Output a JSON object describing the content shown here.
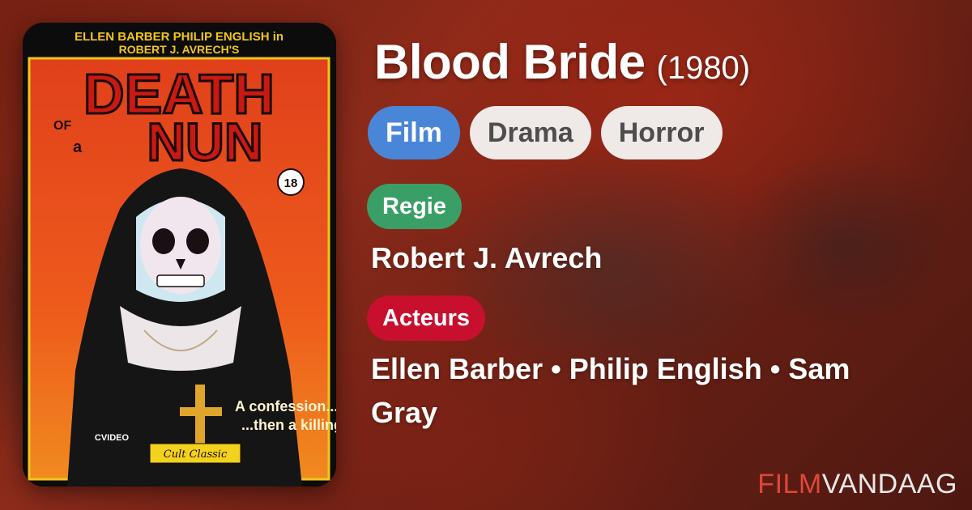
{
  "poster": {
    "credits_line1": "ELLEN BARBER  PHILIP ENGLISH in",
    "credits_line2": "ROBERT J. AVRECH'S",
    "title_word1": "DEATH",
    "title_small_of": "OF",
    "title_small_a": "a",
    "title_word2": "NUN",
    "rating": "18",
    "tagline1": "A confession...",
    "tagline2": "...then a killing.",
    "distributor": "CVIDEO",
    "series": "Cult Classic"
  },
  "film": {
    "title": "Blood Bride",
    "year": "(1980)"
  },
  "tags": [
    "Film",
    "Drama",
    "Horror"
  ],
  "regie": {
    "label": "Regie",
    "value": "Robert J. Avrech"
  },
  "acteurs": {
    "label": "Acteurs",
    "value": "Ellen Barber • Philip English • Sam Gray"
  },
  "brand": {
    "part1": "FILM",
    "part2": "VANDAAG"
  },
  "colors": {
    "tag_primary": "#4a86d8",
    "tag_light": "#efe9e7",
    "regie": "#3a9f66",
    "acteurs": "#c8102e",
    "brand_accent": "#e0463a"
  }
}
